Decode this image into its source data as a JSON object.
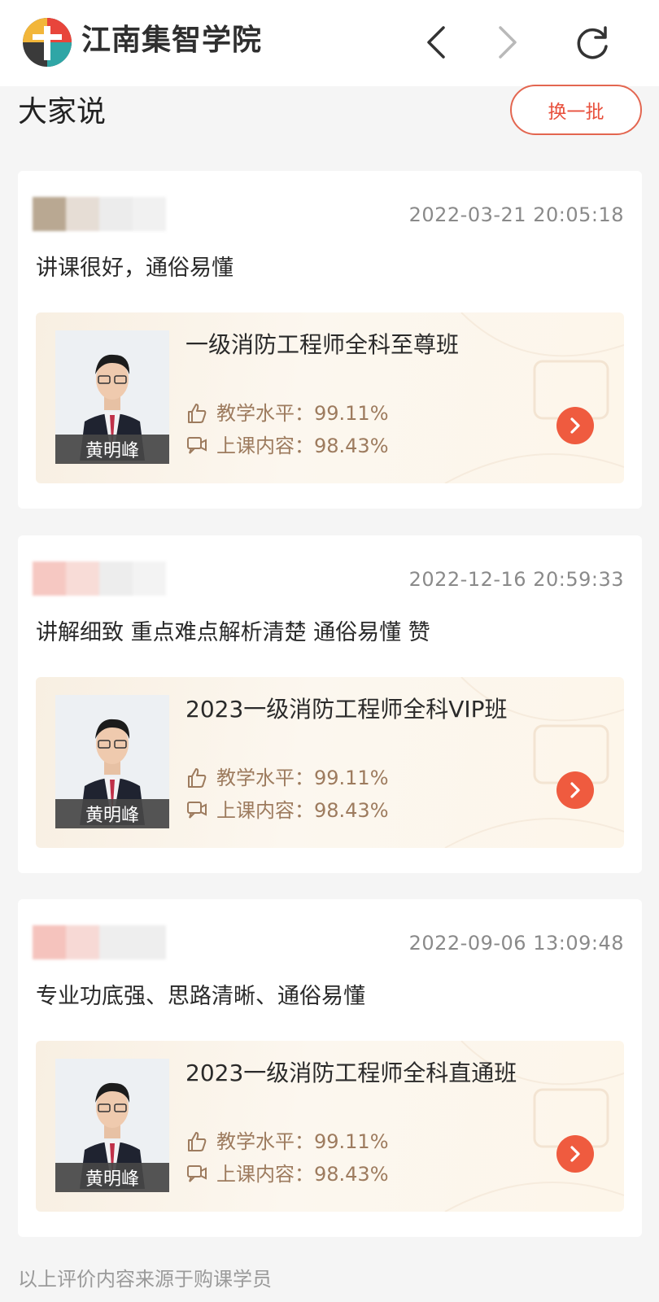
{
  "header": {
    "brand": "江南集智学院",
    "icons": {
      "logo": "brand-logo",
      "back": "chevron-left-icon",
      "forward": "chevron-right-icon",
      "reload": "reload-icon"
    }
  },
  "section": {
    "title": "大家说",
    "swap_label": "换一批"
  },
  "reviews": [
    {
      "date": "2022-03-21 20:05:18",
      "comment": "讲课很好，通俗易懂",
      "avatar_colors": [
        "#b9a892",
        "#e6ddd5",
        "#ececec",
        "#f1f1f1"
      ],
      "course": {
        "title": "一级消防工程师全科至尊班",
        "teacher": "黄明峰",
        "teaching_label": "教学水平：99.11%",
        "content_label": "上课内容：98.43%"
      }
    },
    {
      "date": "2022-12-16 20:59:33",
      "comment": "讲解细致 重点难点解析清楚 通俗易懂 赞",
      "avatar_colors": [
        "#f6c8c2",
        "#f8dcd7",
        "#ededed",
        "#f3f3f3"
      ],
      "course": {
        "title": "2023一级消防工程师全科VIP班",
        "teacher": "黄明峰",
        "teaching_label": "教学水平：99.11%",
        "content_label": "上课内容：98.43%"
      }
    },
    {
      "date": "2022-09-06 13:09:48",
      "comment": "专业功底强、思路清晰、通俗易懂",
      "avatar_colors": [
        "#f5c3bd",
        "#f7d9d5",
        "#eeeeee",
        "#eeeeee"
      ],
      "course": {
        "title": "2023一级消防工程师全科直通班",
        "teacher": "黄明峰",
        "teaching_label": "教学水平：99.11%",
        "content_label": "上课内容：98.43%"
      }
    }
  ],
  "footer": {
    "note": "以上评价内容来源于购课学员"
  },
  "colors": {
    "accent": "#ef5b3f",
    "stat_text": "#9d7b5e",
    "course_bg": "#fcf6ee"
  }
}
